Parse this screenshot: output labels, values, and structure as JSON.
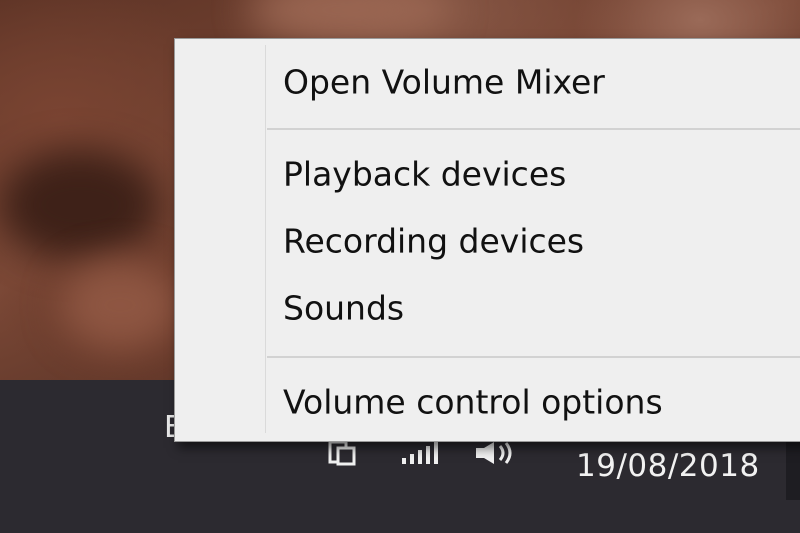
{
  "context_menu": {
    "items": [
      {
        "label": "Open Volume Mixer"
      },
      {
        "label": "Playback devices"
      },
      {
        "label": "Recording devices"
      },
      {
        "label": "Sounds"
      },
      {
        "label": "Volume control options"
      }
    ]
  },
  "taskbar": {
    "clipped_text": "E",
    "clock_date": "19/08/2018",
    "tray_icons": [
      "clipboard-icon",
      "network-signal-icon",
      "speaker-volume-icon"
    ]
  },
  "colors": {
    "menu_background": "#efefef",
    "taskbar_background": "#2c2a30",
    "menu_text": "#111111"
  }
}
